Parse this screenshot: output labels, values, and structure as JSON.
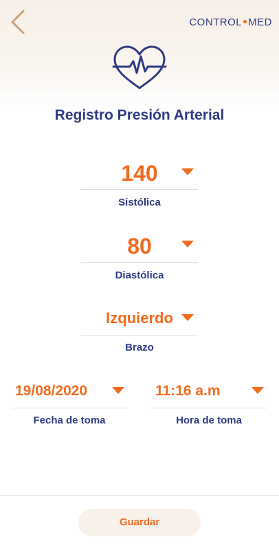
{
  "app": {
    "brand_left": "CONTROL",
    "brand_right": "MED"
  },
  "page": {
    "title": "Registro Presión Arterial"
  },
  "fields": {
    "systolic": {
      "value": "140",
      "label": "Sistólica"
    },
    "diastolic": {
      "value": "80",
      "label": "Diastólica"
    },
    "arm": {
      "value": "Izquierdo",
      "label": "Brazo"
    },
    "date": {
      "value": "19/08/2020",
      "label": "Fecha de toma"
    },
    "time": {
      "value": "11:16 a.m",
      "label": "Hora de toma"
    }
  },
  "actions": {
    "save_label": "Guardar"
  },
  "icons": {
    "back": "chevron-left-icon",
    "header": "heart-pulse-icon",
    "dropdown": "caret-down-icon"
  },
  "colors": {
    "primary": "#2f3a82",
    "accent": "#f26b1d",
    "back_icon": "#c7a27a",
    "header_bg": "#f7f1ea"
  }
}
